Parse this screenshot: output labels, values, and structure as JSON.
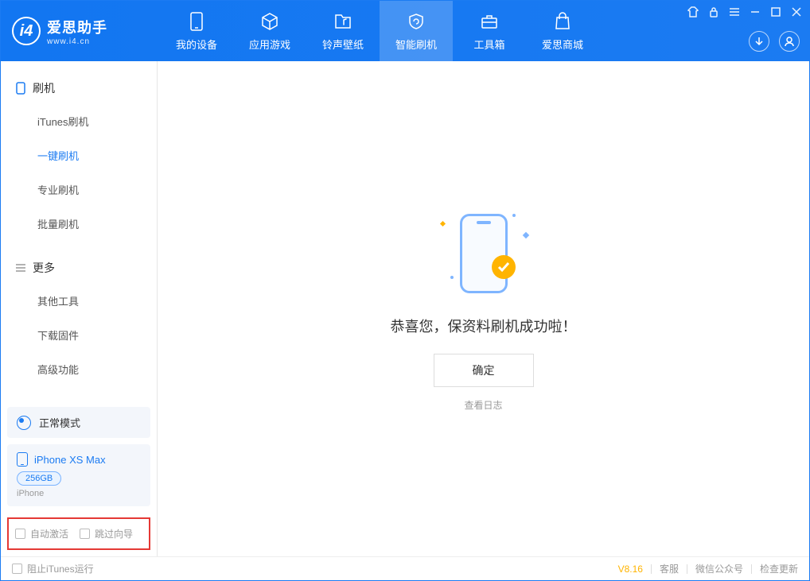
{
  "app": {
    "title": "爱思助手",
    "subtitle": "www.i4.cn"
  },
  "tabs": {
    "device": "我的设备",
    "apps": "应用游戏",
    "ringtone": "铃声壁纸",
    "flash": "智能刷机",
    "toolbox": "工具箱",
    "store": "爱思商城"
  },
  "sidebar": {
    "section1": {
      "title": "刷机",
      "items": [
        "iTunes刷机",
        "一键刷机",
        "专业刷机",
        "批量刷机"
      ]
    },
    "section2": {
      "title": "更多",
      "items": [
        "其他工具",
        "下载固件",
        "高级功能"
      ]
    },
    "mode": "正常模式",
    "device": {
      "name": "iPhone XS Max",
      "capacity": "256GB",
      "type": "iPhone"
    },
    "checkbox_activate": "自动激活",
    "checkbox_skip": "跳过向导"
  },
  "main": {
    "success": "恭喜您，保资料刷机成功啦！",
    "ok": "确定",
    "view_log": "查看日志"
  },
  "footer": {
    "block_itunes": "阻止iTunes运行",
    "version": "V8.16",
    "support": "客服",
    "wechat": "微信公众号",
    "update": "检查更新"
  }
}
